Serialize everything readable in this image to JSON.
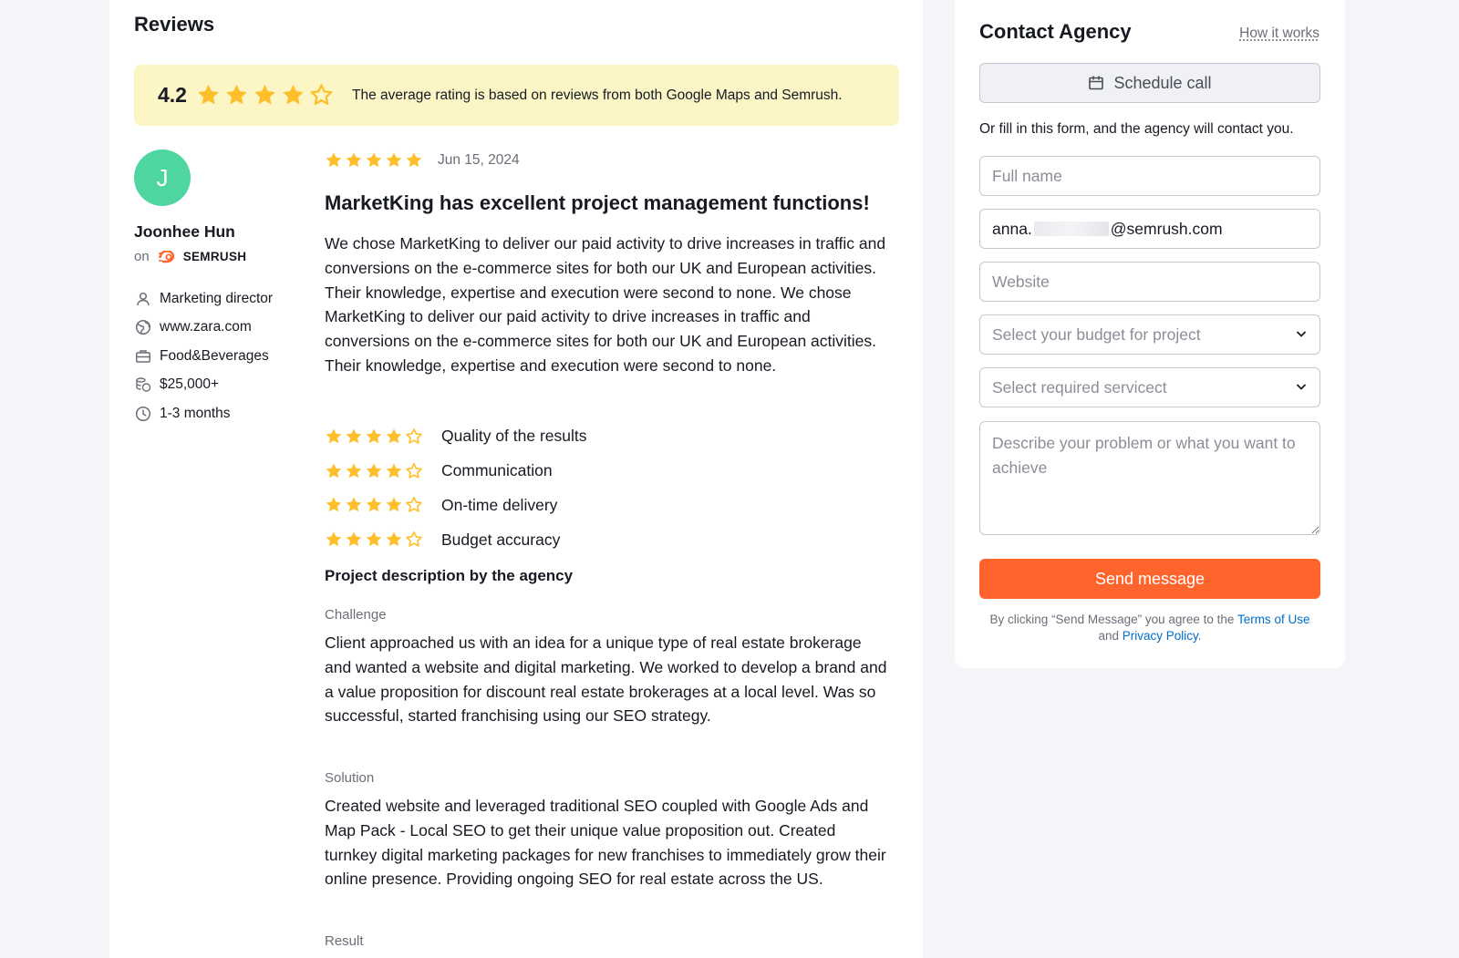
{
  "reviews": {
    "title": "Reviews",
    "average_rating": "4.2",
    "average_stars": 4.2,
    "rating_note": "The average rating is based on reviews from both Google Maps and Semrush."
  },
  "review": {
    "avatar_initial": "J",
    "reviewer_name": "Joonhee Hun",
    "source_prefix": "on",
    "source_name": "SEMRUSH",
    "meta": {
      "role": "Marketing director",
      "website": "www.zara.com",
      "industry": "Food&Beverages",
      "budget": "$25,000+",
      "duration": "1-3 months"
    },
    "stars": 5,
    "date": "Jun 15, 2024",
    "title": "MarketKing has excellent project management functions!",
    "body": "We chose MarketKing to deliver our paid activity to drive increases in traffic and conversions on the e-commerce sites for both our UK and European activities. Their knowledge, expertise and execution were second to none. We chose MarketKing to deliver our paid activity to drive increases in traffic and conversions on the e-commerce sites for both our UK and European activities. Their knowledge, expertise and execution were second to none.",
    "criteria": [
      {
        "label": "Quality of the results",
        "stars": 4
      },
      {
        "label": "Communication",
        "stars": 4
      },
      {
        "label": "On-time delivery",
        "stars": 4
      },
      {
        "label": "Budget accuracy",
        "stars": 4
      }
    ],
    "project_heading": "Project description by the agency",
    "challenge_label": "Challenge",
    "challenge_text": "Client approached us with an idea for a unique type of real estate brokerage and wanted a website and digital marketing. We worked to develop a brand and a value proposition for discount real estate brokerages at a local level. Was so successful, started franchising using our SEO strategy.",
    "solution_label": "Solution",
    "solution_text": "Created website and leveraged traditional SEO coupled with Google Ads and Map Pack - Local SEO to get their unique value proposition out. Created turnkey digital marketing packages for new franchises to immediately grow their online presence. Providing ongoing SEO for real estate across the US.",
    "result_label": "Result"
  },
  "contact": {
    "title": "Contact Agency",
    "how_it_works": "How it works",
    "schedule_call": "Schedule call",
    "form_note": "Or fill in this form, and the agency will contact you.",
    "full_name_placeholder": "Full name",
    "email_prefix": "anna.",
    "email_suffix": "@semrush.com",
    "website_placeholder": "Website",
    "budget_select": "Select your budget for project",
    "service_select": "Select required servicect",
    "message_placeholder": "Describe your problem or what you want to achieve",
    "send_button": "Send message",
    "terms_prefix": "By clicking “Send Message” you agree to the",
    "terms_link": "Terms of Use",
    "terms_and": "and",
    "privacy_link": "Privacy Policy",
    "terms_period": "."
  },
  "colors": {
    "star": "#ffbf2a",
    "star_outline": "#ffbf2a",
    "accent": "#ff642d",
    "link": "#006dca",
    "banner": "#fcf5c6",
    "avatar": "#4fd6a0"
  }
}
